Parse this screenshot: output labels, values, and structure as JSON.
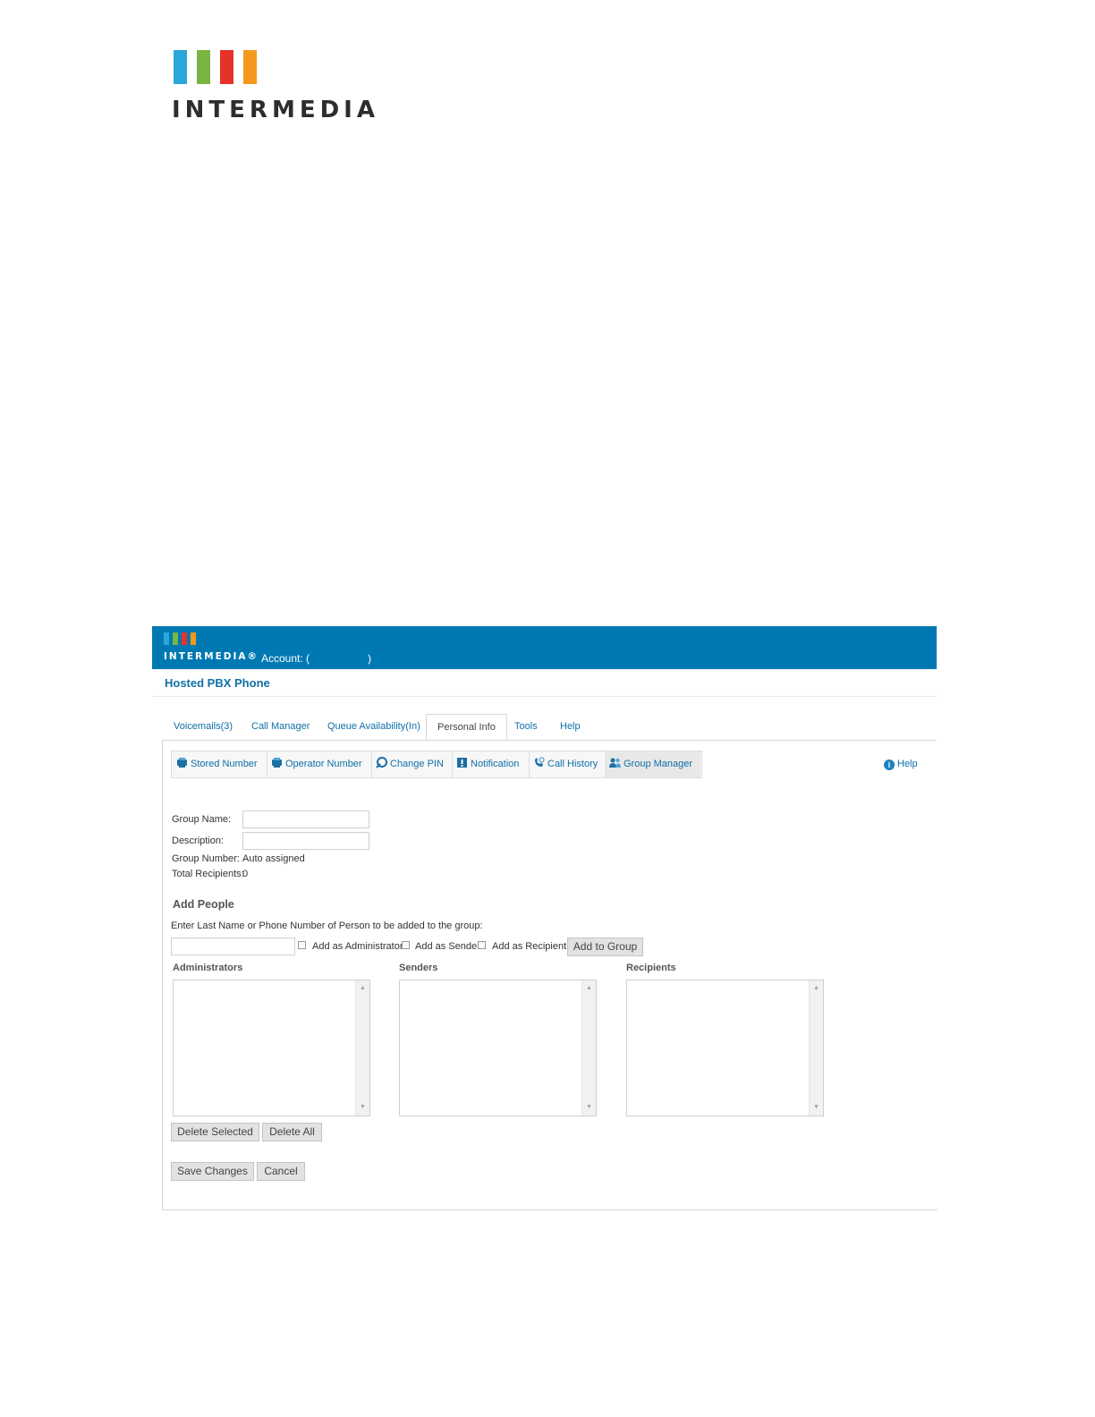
{
  "logo": {
    "wordmark": "INTERMEDIA",
    "bar_colors": [
      "#2aa7d9",
      "#7ab442",
      "#e6332a",
      "#f39a1e"
    ]
  },
  "header": {
    "brand": "INTERMEDIA®",
    "account_label": "Account: (",
    "account_close": ")",
    "bg_color": "#0079b3"
  },
  "app_title": "Hosted PBX Phone",
  "tabs": [
    {
      "label": "Voicemails(3)"
    },
    {
      "label": "Call Manager"
    },
    {
      "label": "Queue Availability(In)"
    },
    {
      "label": "Personal Info",
      "active": true
    },
    {
      "label": "Tools"
    },
    {
      "label": "Help"
    }
  ],
  "subnav": [
    {
      "label": "Stored Number",
      "icon": "stored-number-icon"
    },
    {
      "label": "Operator Number",
      "icon": "operator-number-icon"
    },
    {
      "label": "Change PIN",
      "icon": "change-pin-icon"
    },
    {
      "label": "Notification",
      "icon": "notification-icon"
    },
    {
      "label": "Call History",
      "icon": "call-history-icon"
    },
    {
      "label": "Group Manager",
      "icon": "group-manager-icon",
      "active": true
    }
  ],
  "help_link": "Help",
  "form": {
    "group_name_label": "Group Name:",
    "group_name_value": "",
    "description_label": "Description:",
    "description_value": "",
    "group_number_label": "Group Number:",
    "group_number_value": "Auto assigned",
    "total_recipients_label": "Total Recipients:",
    "total_recipients_value": "0"
  },
  "add_people": {
    "heading": "Add People",
    "instruction": "Enter Last Name or Phone Number of Person to be added to the group:",
    "search_value": "",
    "add_as_admin_label": "Add as Administrator",
    "add_as_sender_label": "Add as Sender",
    "add_as_recipient_label": "Add as Recipient",
    "add_to_group_button": "Add to Group"
  },
  "lists": {
    "administrators_heading": "Administrators",
    "senders_heading": "Senders",
    "recipients_heading": "Recipients"
  },
  "buttons": {
    "delete_selected": "Delete Selected",
    "delete_all": "Delete All",
    "save_changes": "Save Changes",
    "cancel": "Cancel"
  }
}
